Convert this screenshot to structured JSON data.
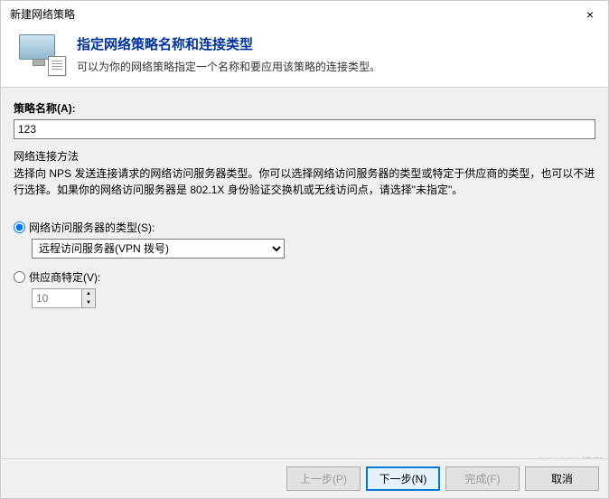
{
  "window": {
    "title": "新建网络策略",
    "close_label": "×"
  },
  "header": {
    "heading": "指定网络策略名称和连接类型",
    "subheading": "可以为你的网络策略指定一个名称和要应用该策略的连接类型。"
  },
  "form": {
    "policy_name_label": "策略名称(A):",
    "policy_name_value": "123",
    "connection_method_label": "网络连接方法",
    "connection_method_desc": "选择向 NPS 发送连接请求的网络访问服务器类型。你可以选择网络访问服务器的类型或特定于供应商的类型，也可以不进行选择。如果你的网络访问服务器是 802.1X 身份验证交换机或无线访问点，请选择\"未指定\"。",
    "radio_server_type_label": "网络访问服务器的类型(S):",
    "server_type_selected": "远程访问服务器(VPN 拨号)",
    "radio_vendor_label": "供应商特定(V):",
    "vendor_value": "10"
  },
  "footer": {
    "back": "上一步(P)",
    "next": "下一步(N)",
    "finish": "完成(F)",
    "cancel": "取消"
  },
  "watermark": "@51CTO博客"
}
